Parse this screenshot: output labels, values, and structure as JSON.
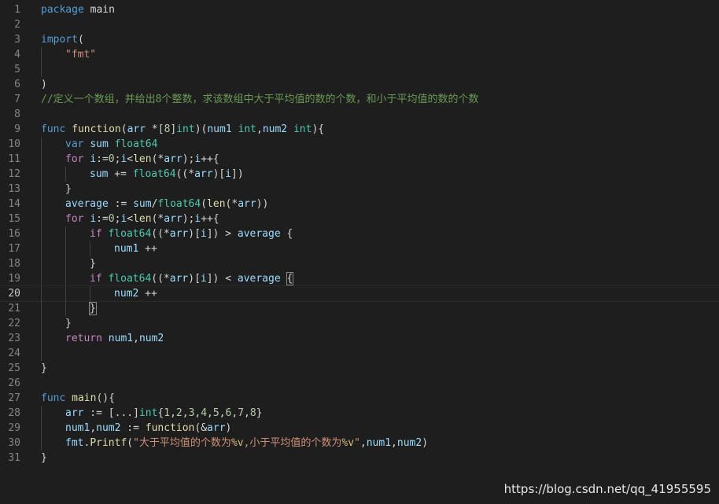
{
  "editor": {
    "current_line": 20,
    "lines": [
      {
        "n": "1",
        "tokens": [
          [
            "t-kw",
            "package"
          ],
          [
            "t-plain",
            " main"
          ]
        ]
      },
      {
        "n": "2",
        "tokens": []
      },
      {
        "n": "3",
        "tokens": [
          [
            "t-kw",
            "import"
          ],
          [
            "t-plain",
            "("
          ]
        ]
      },
      {
        "n": "4",
        "tokens": [
          [
            "t-str",
            "\"fmt\""
          ]
        ]
      },
      {
        "n": "5",
        "tokens": []
      },
      {
        "n": "6",
        "tokens": [
          [
            "t-plain",
            ")"
          ]
        ]
      },
      {
        "n": "7",
        "tokens": [
          [
            "t-cmt",
            "//定义一个数组，并给出8个整数，求该数组中大于平均值的数的个数，和小于平均值的数的个数"
          ]
        ]
      },
      {
        "n": "8",
        "tokens": []
      },
      {
        "n": "9",
        "tokens": [
          [
            "t-kw",
            "func"
          ],
          [
            "t-plain",
            " "
          ],
          [
            "t-fn",
            "function"
          ],
          [
            "t-plain",
            "("
          ],
          [
            "t-var",
            "arr"
          ],
          [
            "t-plain",
            " *["
          ],
          [
            "t-num",
            "8"
          ],
          [
            "t-plain",
            "]"
          ],
          [
            "t-type",
            "int"
          ],
          [
            "t-plain",
            ")("
          ],
          [
            "t-var",
            "num1"
          ],
          [
            "t-plain",
            " "
          ],
          [
            "t-type",
            "int"
          ],
          [
            "t-plain",
            ","
          ],
          [
            "t-var",
            "num2"
          ],
          [
            "t-plain",
            " "
          ],
          [
            "t-type",
            "int"
          ],
          [
            "t-plain",
            "){"
          ]
        ]
      },
      {
        "n": "10",
        "tokens": [
          [
            "t-kw",
            "var"
          ],
          [
            "t-plain",
            " "
          ],
          [
            "t-var",
            "sum"
          ],
          [
            "t-plain",
            " "
          ],
          [
            "t-type",
            "float64"
          ]
        ]
      },
      {
        "n": "11",
        "tokens": [
          [
            "t-ctl",
            "for"
          ],
          [
            "t-plain",
            " "
          ],
          [
            "t-var",
            "i"
          ],
          [
            "t-plain",
            ":="
          ],
          [
            "t-num",
            "0"
          ],
          [
            "t-plain",
            ";"
          ],
          [
            "t-var",
            "i"
          ],
          [
            "t-plain",
            "<"
          ],
          [
            "t-fn",
            "len"
          ],
          [
            "t-plain",
            "(*"
          ],
          [
            "t-var",
            "arr"
          ],
          [
            "t-plain",
            ");"
          ],
          [
            "t-var",
            "i"
          ],
          [
            "t-plain",
            "++{"
          ]
        ]
      },
      {
        "n": "12",
        "tokens": [
          [
            "t-var",
            "sum"
          ],
          [
            "t-plain",
            " += "
          ],
          [
            "t-type",
            "float64"
          ],
          [
            "t-plain",
            "((*"
          ],
          [
            "t-var",
            "arr"
          ],
          [
            "t-plain",
            ")["
          ],
          [
            "t-var",
            "i"
          ],
          [
            "t-plain",
            "])"
          ]
        ]
      },
      {
        "n": "13",
        "tokens": [
          [
            "t-plain",
            "}"
          ]
        ]
      },
      {
        "n": "14",
        "tokens": [
          [
            "t-var",
            "average"
          ],
          [
            "t-plain",
            " := "
          ],
          [
            "t-var",
            "sum"
          ],
          [
            "t-plain",
            "/"
          ],
          [
            "t-type",
            "float64"
          ],
          [
            "t-plain",
            "("
          ],
          [
            "t-fn",
            "len"
          ],
          [
            "t-plain",
            "(*"
          ],
          [
            "t-var",
            "arr"
          ],
          [
            "t-plain",
            "))"
          ]
        ]
      },
      {
        "n": "15",
        "tokens": [
          [
            "t-ctl",
            "for"
          ],
          [
            "t-plain",
            " "
          ],
          [
            "t-var",
            "i"
          ],
          [
            "t-plain",
            ":="
          ],
          [
            "t-num",
            "0"
          ],
          [
            "t-plain",
            ";"
          ],
          [
            "t-var",
            "i"
          ],
          [
            "t-plain",
            "<"
          ],
          [
            "t-fn",
            "len"
          ],
          [
            "t-plain",
            "(*"
          ],
          [
            "t-var",
            "arr"
          ],
          [
            "t-plain",
            ");"
          ],
          [
            "t-var",
            "i"
          ],
          [
            "t-plain",
            "++{"
          ]
        ]
      },
      {
        "n": "16",
        "tokens": [
          [
            "t-ctl",
            "if"
          ],
          [
            "t-plain",
            " "
          ],
          [
            "t-type",
            "float64"
          ],
          [
            "t-plain",
            "((*"
          ],
          [
            "t-var",
            "arr"
          ],
          [
            "t-plain",
            ")["
          ],
          [
            "t-var",
            "i"
          ],
          [
            "t-plain",
            "]) > "
          ],
          [
            "t-var",
            "average"
          ],
          [
            "t-plain",
            " {"
          ]
        ]
      },
      {
        "n": "17",
        "tokens": [
          [
            "t-var",
            "num1"
          ],
          [
            "t-plain",
            " ++"
          ]
        ]
      },
      {
        "n": "18",
        "tokens": [
          [
            "t-plain",
            "}"
          ]
        ]
      },
      {
        "n": "19",
        "tokens": [
          [
            "t-ctl",
            "if"
          ],
          [
            "t-plain",
            " "
          ],
          [
            "t-type",
            "float64"
          ],
          [
            "t-plain",
            "((*"
          ],
          [
            "t-var",
            "arr"
          ],
          [
            "t-plain",
            ")["
          ],
          [
            "t-var",
            "i"
          ],
          [
            "t-plain",
            "]) < "
          ],
          [
            "t-var",
            "average"
          ],
          [
            "t-plain",
            " "
          ],
          [
            "bracket-match",
            "{"
          ]
        ]
      },
      {
        "n": "20",
        "tokens": [
          [
            "t-var",
            "num2"
          ],
          [
            "t-plain",
            " ++"
          ]
        ]
      },
      {
        "n": "21",
        "tokens": [
          [
            "bracket-match",
            "}"
          ]
        ]
      },
      {
        "n": "22",
        "tokens": [
          [
            "t-plain",
            "}"
          ]
        ]
      },
      {
        "n": "23",
        "tokens": [
          [
            "t-ctl",
            "return"
          ],
          [
            "t-plain",
            " "
          ],
          [
            "t-var",
            "num1"
          ],
          [
            "t-plain",
            ","
          ],
          [
            "t-var",
            "num2"
          ]
        ]
      },
      {
        "n": "24",
        "tokens": []
      },
      {
        "n": "25",
        "tokens": [
          [
            "t-plain",
            "}"
          ]
        ]
      },
      {
        "n": "26",
        "tokens": []
      },
      {
        "n": "27",
        "tokens": [
          [
            "t-kw",
            "func"
          ],
          [
            "t-plain",
            " "
          ],
          [
            "t-fn",
            "main"
          ],
          [
            "t-plain",
            "(){"
          ]
        ]
      },
      {
        "n": "28",
        "tokens": [
          [
            "t-var",
            "arr"
          ],
          [
            "t-plain",
            " := [...]"
          ],
          [
            "t-type",
            "int"
          ],
          [
            "t-plain",
            "{"
          ],
          [
            "t-num",
            "1"
          ],
          [
            "t-plain",
            ","
          ],
          [
            "t-num",
            "2"
          ],
          [
            "t-plain",
            ","
          ],
          [
            "t-num",
            "3"
          ],
          [
            "t-plain",
            ","
          ],
          [
            "t-num",
            "4"
          ],
          [
            "t-plain",
            ","
          ],
          [
            "t-num",
            "5"
          ],
          [
            "t-plain",
            ","
          ],
          [
            "t-num",
            "6"
          ],
          [
            "t-plain",
            ","
          ],
          [
            "t-num",
            "7"
          ],
          [
            "t-plain",
            ","
          ],
          [
            "t-num",
            "8"
          ],
          [
            "t-plain",
            "}"
          ]
        ]
      },
      {
        "n": "29",
        "tokens": [
          [
            "t-var",
            "num1"
          ],
          [
            "t-plain",
            ","
          ],
          [
            "t-var",
            "num2"
          ],
          [
            "t-plain",
            " := "
          ],
          [
            "t-fn",
            "function"
          ],
          [
            "t-plain",
            "(&"
          ],
          [
            "t-var",
            "arr"
          ],
          [
            "t-plain",
            ")"
          ]
        ]
      },
      {
        "n": "30",
        "tokens": [
          [
            "t-var",
            "fmt"
          ],
          [
            "t-plain",
            "."
          ],
          [
            "t-fn",
            "Printf"
          ],
          [
            "t-plain",
            "("
          ],
          [
            "t-str",
            "\"大于平均值的个数为"
          ],
          [
            "t-esc",
            "%v"
          ],
          [
            "t-str",
            ",小于平均值的个数为"
          ],
          [
            "t-esc",
            "%v"
          ],
          [
            "t-str",
            "\""
          ],
          [
            "t-plain",
            ","
          ],
          [
            "t-var",
            "num1"
          ],
          [
            "t-plain",
            ","
          ],
          [
            "t-var",
            "num2"
          ],
          [
            "t-plain",
            ")"
          ]
        ]
      },
      {
        "n": "31",
        "tokens": [
          [
            "t-plain",
            "}"
          ]
        ]
      }
    ]
  },
  "watermark": "https://blog.csdn.net/qq_41955595"
}
